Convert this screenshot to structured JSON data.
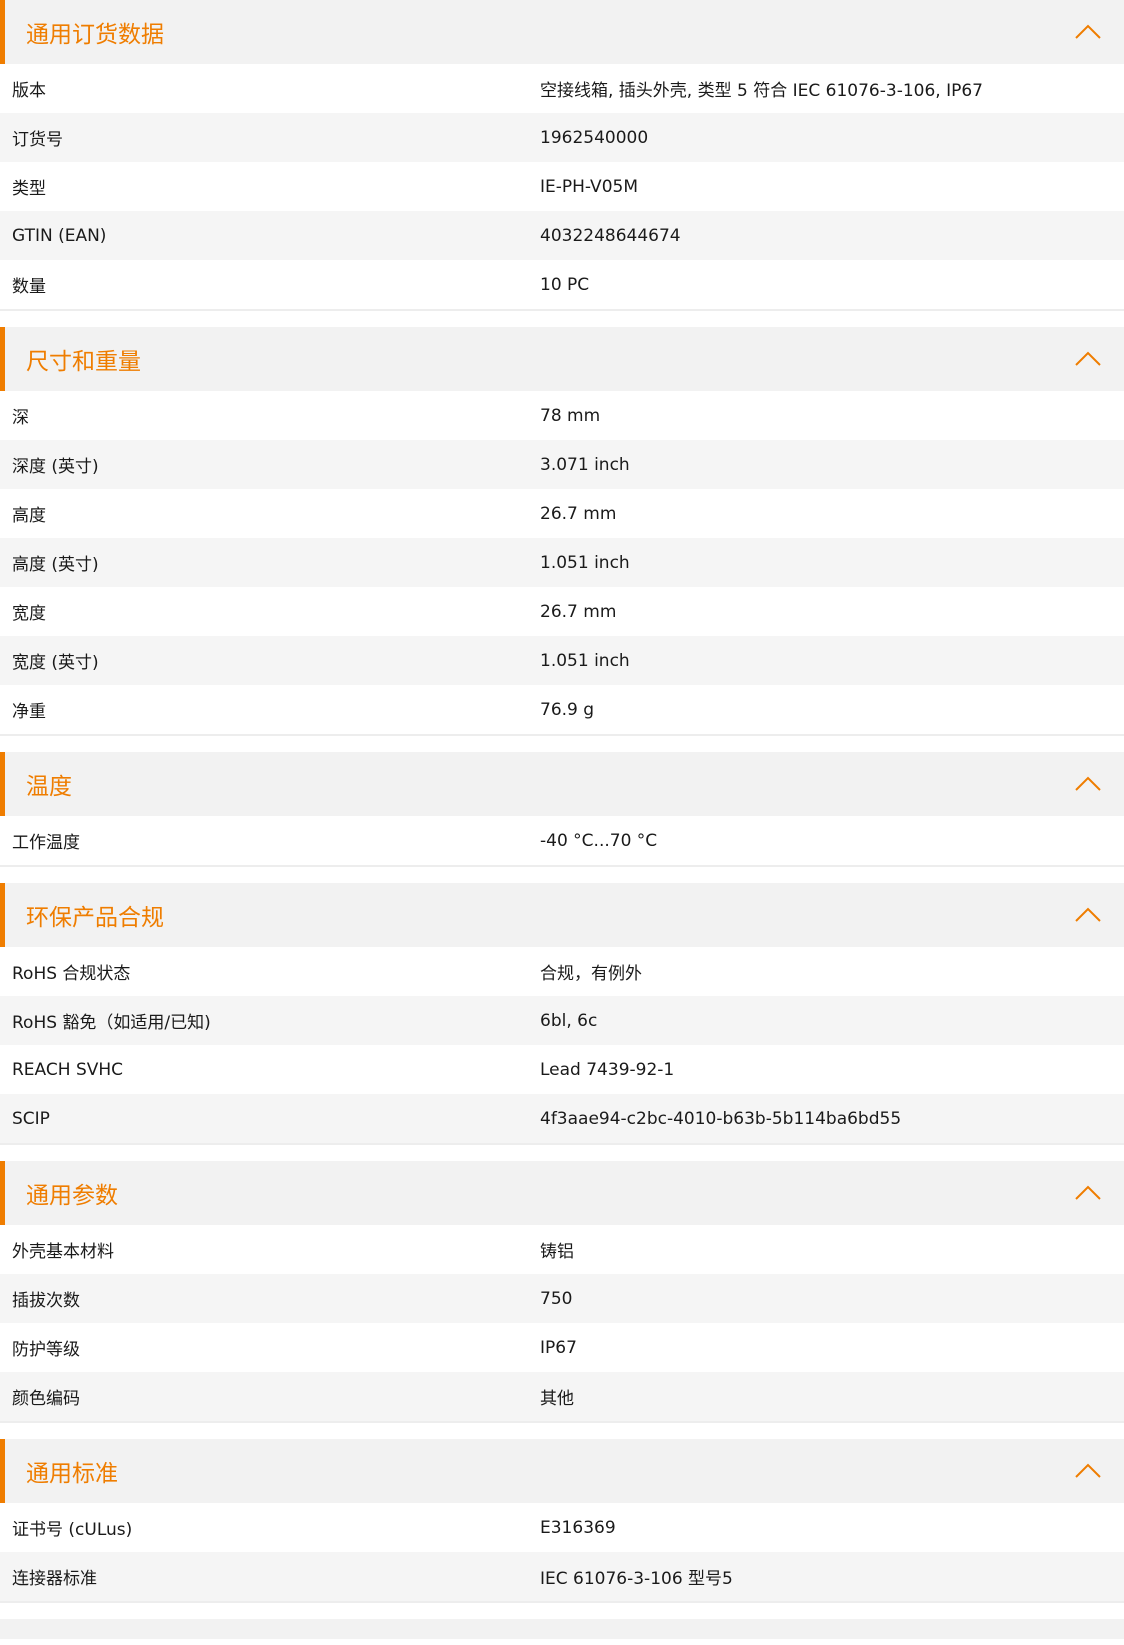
{
  "sections": [
    {
      "title": "通用订货数据",
      "rows": [
        {
          "label": "版本",
          "value": "空接线箱, 插头外壳, 类型 5 符合 IEC 61076-3-106, IP67"
        },
        {
          "label": "订货号",
          "value": "1962540000"
        },
        {
          "label": "类型",
          "value": "IE-PH-V05M"
        },
        {
          "label": "GTIN (EAN)",
          "value": "4032248644674"
        },
        {
          "label": "数量",
          "value": "10  PC"
        }
      ]
    },
    {
      "title": "尺寸和重量",
      "rows": [
        {
          "label": "深",
          "value": "78  mm"
        },
        {
          "label": "深度 (英寸)",
          "value": "3.071  inch"
        },
        {
          "label": "高度",
          "value": "26.7  mm"
        },
        {
          "label": "高度 (英寸)",
          "value": "1.051  inch"
        },
        {
          "label": "宽度",
          "value": "26.7  mm"
        },
        {
          "label": "宽度 (英寸)",
          "value": "1.051  inch"
        },
        {
          "label": "净重",
          "value": "76.9  g"
        }
      ]
    },
    {
      "title": "温度",
      "rows": [
        {
          "label": "工作温度",
          "value": "-40 °C...70 °C"
        }
      ]
    },
    {
      "title": "环保产品合规",
      "rows": [
        {
          "label": "RoHS 合规状态",
          "value": "合规，有例外"
        },
        {
          "label": "RoHS 豁免（如适用/已知)",
          "value": "6bl, 6c"
        },
        {
          "label": "REACH SVHC",
          "value": "Lead 7439-92-1"
        },
        {
          "label": "SCIP",
          "value": "4f3aae94-c2bc-4010-b63b-5b114ba6bd55"
        }
      ]
    },
    {
      "title": "通用参数",
      "rows": [
        {
          "label": "外壳基本材料",
          "value": "铸铝"
        },
        {
          "label": "插拔次数",
          "value": "750"
        },
        {
          "label": "防护等级",
          "value": "IP67"
        },
        {
          "label": "颜色编码",
          "value": "其他"
        }
      ]
    },
    {
      "title": "通用标准",
      "rows": [
        {
          "label": "证书号 (cULus)",
          "value": "E316369"
        },
        {
          "label": "连接器标准",
          "value": "IEC 61076-3-106 型号5"
        }
      ]
    }
  ],
  "theme": {
    "accent": "#ef7d00",
    "header_bg": "#f2f2f2",
    "row_alt_bg": "#f5f5f5"
  },
  "icons": {
    "collapse": "chevron-up-icon"
  }
}
